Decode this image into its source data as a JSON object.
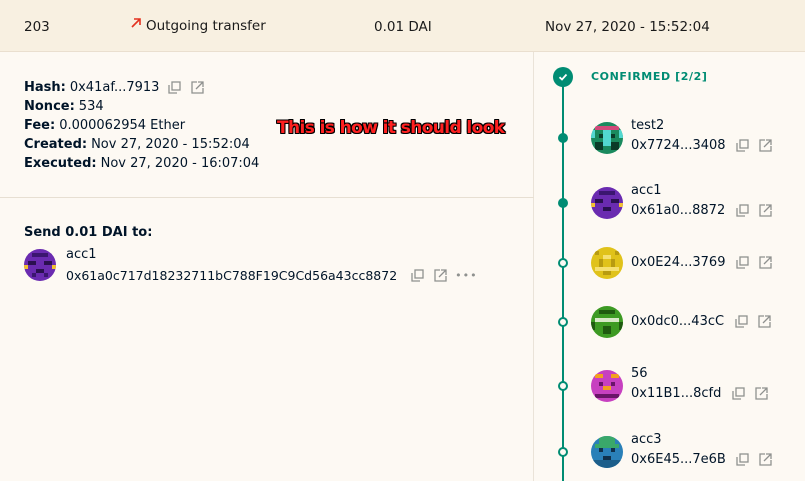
{
  "header": {
    "id": "203",
    "type_label": "Outgoing transfer",
    "amount": "0.01 DAI",
    "date": "Nov 27, 2020 - 15:52:04"
  },
  "details": {
    "hash_label": "Hash:",
    "hash_value": "0x41af...7913",
    "nonce_label": "Nonce:",
    "nonce_value": "534",
    "fee_label": "Fee:",
    "fee_value": "0.000062954 Ether",
    "created_label": "Created:",
    "created_value": "Nov 27, 2020 - 15:52:04",
    "executed_label": "Executed:",
    "executed_value": "Nov 27, 2020 - 16:07:04"
  },
  "annotation": "This is how it should look",
  "send": {
    "title": "Send 0.01 DAI to:",
    "recipient_name": "acc1",
    "recipient_address": "0x61a0c717d18232711bC788F19C9Cd56a43cc8872",
    "more": "•••"
  },
  "confirmations": {
    "status": "CONFIRMED [2/2]",
    "owners": [
      {
        "name": "test2",
        "address": "0x7724...3408",
        "confirmed": true,
        "avatar_color": "#1a8a5e"
      },
      {
        "name": "acc1",
        "address": "0x61a0...8872",
        "confirmed": true,
        "avatar_color": "#6a2bb0"
      },
      {
        "name": "",
        "address": "0x0E24...3769",
        "confirmed": false,
        "avatar_color": "#e0c21a"
      },
      {
        "name": "",
        "address": "0x0dc0...43cC",
        "confirmed": false,
        "avatar_color": "#3d9a23"
      },
      {
        "name": "56",
        "address": "0x11B1...8cfd",
        "confirmed": false,
        "avatar_color": "#c740c0"
      },
      {
        "name": "acc3",
        "address": "0x6E45...7e6B",
        "confirmed": false,
        "avatar_color": "#2a80b8"
      }
    ]
  },
  "colors": {
    "accent": "#008c73",
    "outgoing_arrow": "#e4311f",
    "header_bg": "#f8f0e1",
    "page_bg": "#fdf9f3"
  }
}
